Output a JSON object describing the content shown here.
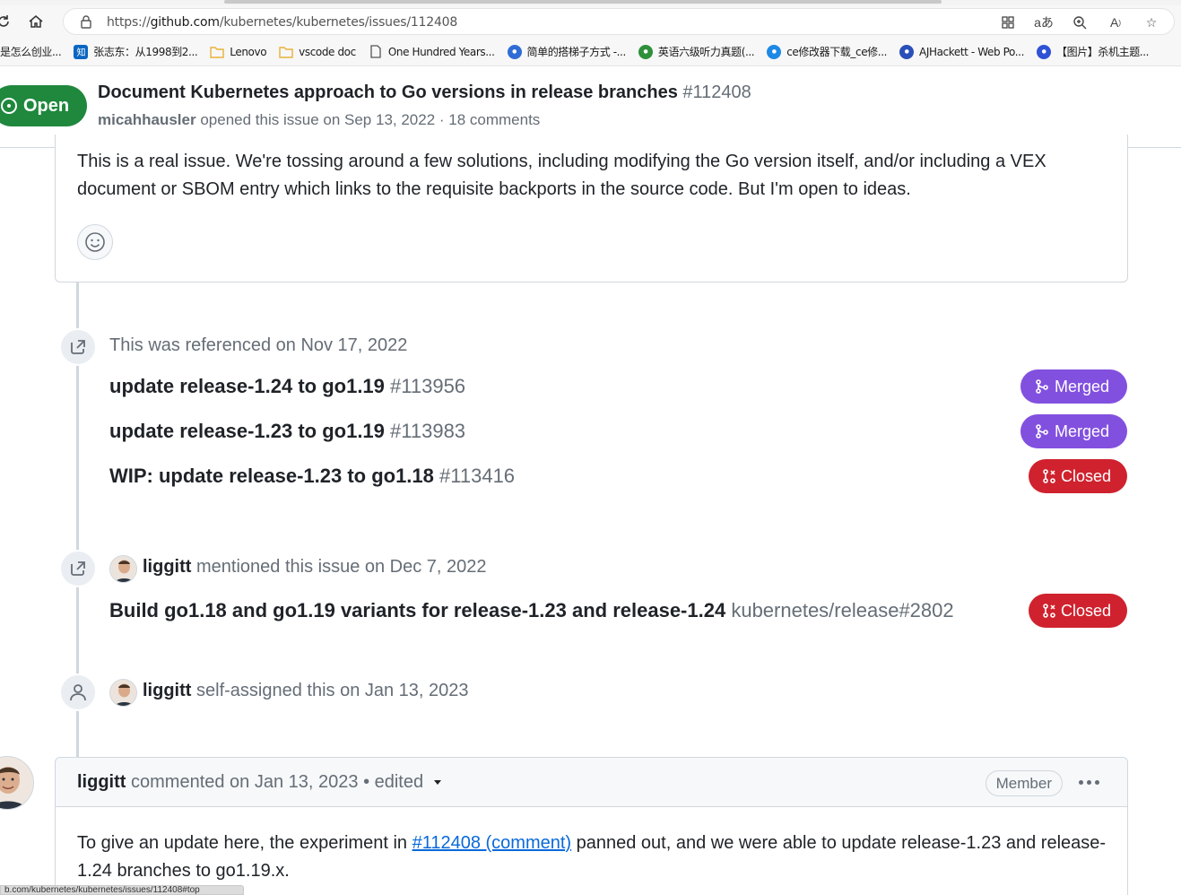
{
  "browser": {
    "url_prefix": "https://",
    "url_host": "github.com",
    "url_path": "/kubernetes/kubernetes/issues/112408",
    "status_url": "b.com/kubernetes/kubernetes/issues/112408#top",
    "bookmarks": [
      {
        "label": "是怎么创业...",
        "icon": "none",
        "color": ""
      },
      {
        "label": "张志东：从1998到2...",
        "icon": "zhihu-icon",
        "color": "#0a66c2"
      },
      {
        "label": "Lenovo",
        "icon": "folder-icon",
        "color": "#e8b23a"
      },
      {
        "label": "vscode doc",
        "icon": "folder-icon",
        "color": "#e8b23a"
      },
      {
        "label": "One Hundred Years...",
        "icon": "document-icon",
        "color": "#555555"
      },
      {
        "label": "简单的搭梯子方式 -...",
        "icon": "globe-icon",
        "color": "#2f6cd6"
      },
      {
        "label": "英语六级听力真题(...",
        "icon": "leaf-icon",
        "color": "#2f8f3a"
      },
      {
        "label": "ce修改器下载_ce修...",
        "icon": "site-icon",
        "color": "#1e88e5"
      },
      {
        "label": "AJHackett - Web Po...",
        "icon": "site-icon",
        "color": "#2a4fb8"
      },
      {
        "label": "【图片】杀机主题...",
        "icon": "paw-icon",
        "color": "#2f52d6"
      }
    ]
  },
  "issue": {
    "state": "Open",
    "title": "Document Kubernetes approach to Go versions in release branches",
    "number": "#112408",
    "author": "micahhausler",
    "meta": "opened this issue on Sep 13, 2022 · 18 comments"
  },
  "comment1": {
    "body": "This is a real issue. We're tossing around a few solutions, including modifying the Go version itself, and/or including a VEX document or SBOM entry which links to the requisite backports in the source code. But I'm open to ideas."
  },
  "events": {
    "referenced": {
      "text": "This was referenced on Nov 17, 2022",
      "items": [
        {
          "title": "update release-1.24 to go1.19",
          "number": "#113956",
          "state": "Merged"
        },
        {
          "title": "update release-1.23 to go1.19",
          "number": "#113983",
          "state": "Merged"
        },
        {
          "title": "WIP: update release-1.23 to go1.18",
          "number": "#113416",
          "state": "Closed"
        }
      ]
    },
    "mentioned": {
      "user": "liggitt",
      "text": "mentioned this issue on Dec 7, 2022",
      "item": {
        "title": "Build go1.18 and go1.19 variants for release-1.23 and release-1.24",
        "number": "kubernetes/release#2802",
        "state": "Closed"
      }
    },
    "assigned": {
      "user": "liggitt",
      "text": "self-assigned this on Jan 13, 2023"
    }
  },
  "comment2": {
    "author": "liggitt",
    "meta": "commented on Jan 13, 2023 • edited",
    "badge": "Member",
    "body_before": "To give an update here, the experiment in ",
    "link": "#112408 (comment)",
    "body_after": " panned out, and we were able to update release-1.23 and release-1.24 branches to go1.19.x."
  },
  "colors": {
    "open": "#1f883d",
    "merged": "#8250df",
    "closed": "#cf222e",
    "link": "#0969da"
  }
}
